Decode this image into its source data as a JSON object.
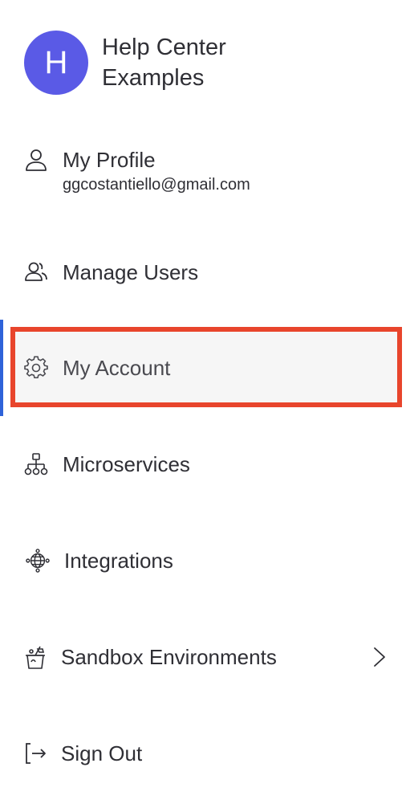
{
  "header": {
    "avatar_letter": "H",
    "title": "Help Center Examples"
  },
  "menu": {
    "profile": {
      "label": "My Profile",
      "email": "ggcostantiello@gmail.com",
      "icon": "user-icon"
    },
    "items": [
      {
        "label": "Manage Users",
        "icon": "users-icon"
      },
      {
        "label": "My Account",
        "icon": "gear-icon",
        "active": true,
        "highlighted": true
      },
      {
        "label": "Microservices",
        "icon": "hierarchy-icon"
      },
      {
        "label": "Integrations",
        "icon": "globe-network-icon"
      },
      {
        "label": "Sandbox Environments",
        "icon": "sandbox-icon",
        "has_submenu": true
      },
      {
        "label": "Sign Out",
        "icon": "sign-out-icon"
      }
    ]
  },
  "colors": {
    "avatar": "#5a5ae6",
    "active_indicator": "#2f63d9",
    "highlight_border": "#e8452c",
    "active_background": "#f6f6f6"
  }
}
